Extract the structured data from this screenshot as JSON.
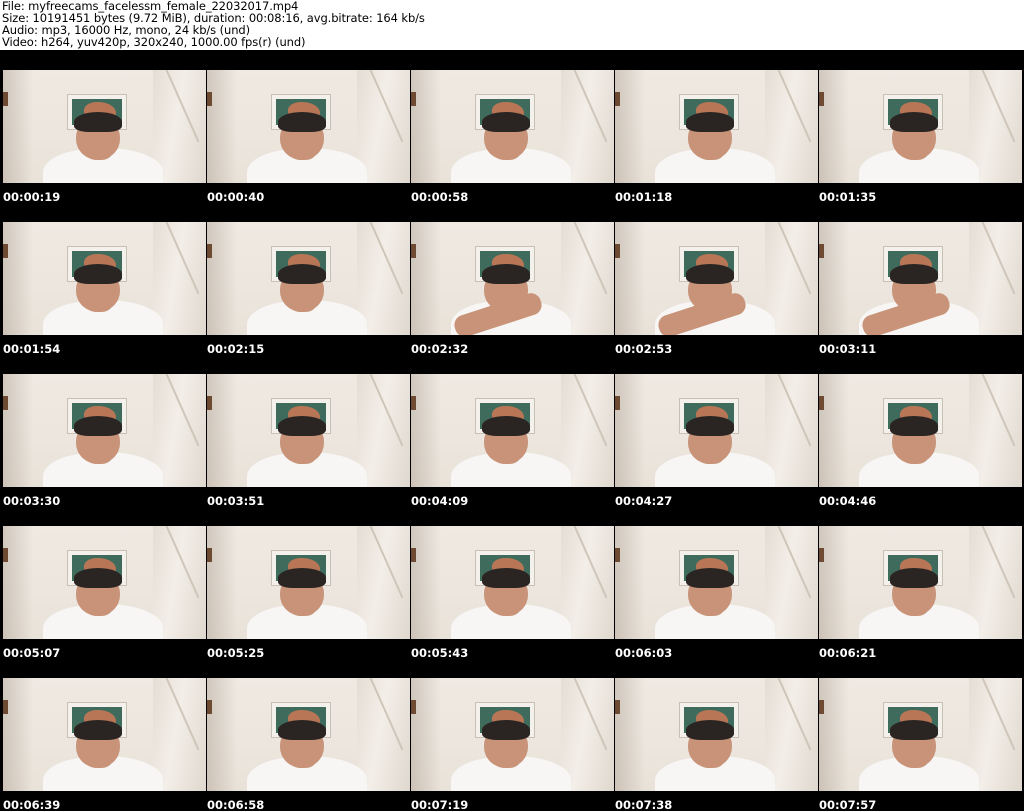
{
  "header": {
    "file": "File: myfreecams_facelessm_female_22032017.mp4",
    "size": "Size: 10191451 bytes (9.72 MiB), duration: 00:08:16, avg.bitrate: 164 kb/s",
    "audio": "Audio: mp3, 16000 Hz, mono, 24 kb/s (und)",
    "video": "Video: h264, yuv420p, 320x240, 1000.00 fps(r) (und)"
  },
  "thumbnails": [
    {
      "time": "00:00:19"
    },
    {
      "time": "00:00:40"
    },
    {
      "time": "00:00:58"
    },
    {
      "time": "00:01:18"
    },
    {
      "time": "00:01:35"
    },
    {
      "time": "00:01:54"
    },
    {
      "time": "00:02:15"
    },
    {
      "time": "00:02:32"
    },
    {
      "time": "00:02:53"
    },
    {
      "time": "00:03:11"
    },
    {
      "time": "00:03:30"
    },
    {
      "time": "00:03:51"
    },
    {
      "time": "00:04:09"
    },
    {
      "time": "00:04:27"
    },
    {
      "time": "00:04:46"
    },
    {
      "time": "00:05:07"
    },
    {
      "time": "00:05:25"
    },
    {
      "time": "00:05:43"
    },
    {
      "time": "00:06:03"
    },
    {
      "time": "00:06:21"
    },
    {
      "time": "00:06:39"
    },
    {
      "time": "00:06:58"
    },
    {
      "time": "00:07:19"
    },
    {
      "time": "00:07:38"
    },
    {
      "time": "00:07:57"
    }
  ]
}
